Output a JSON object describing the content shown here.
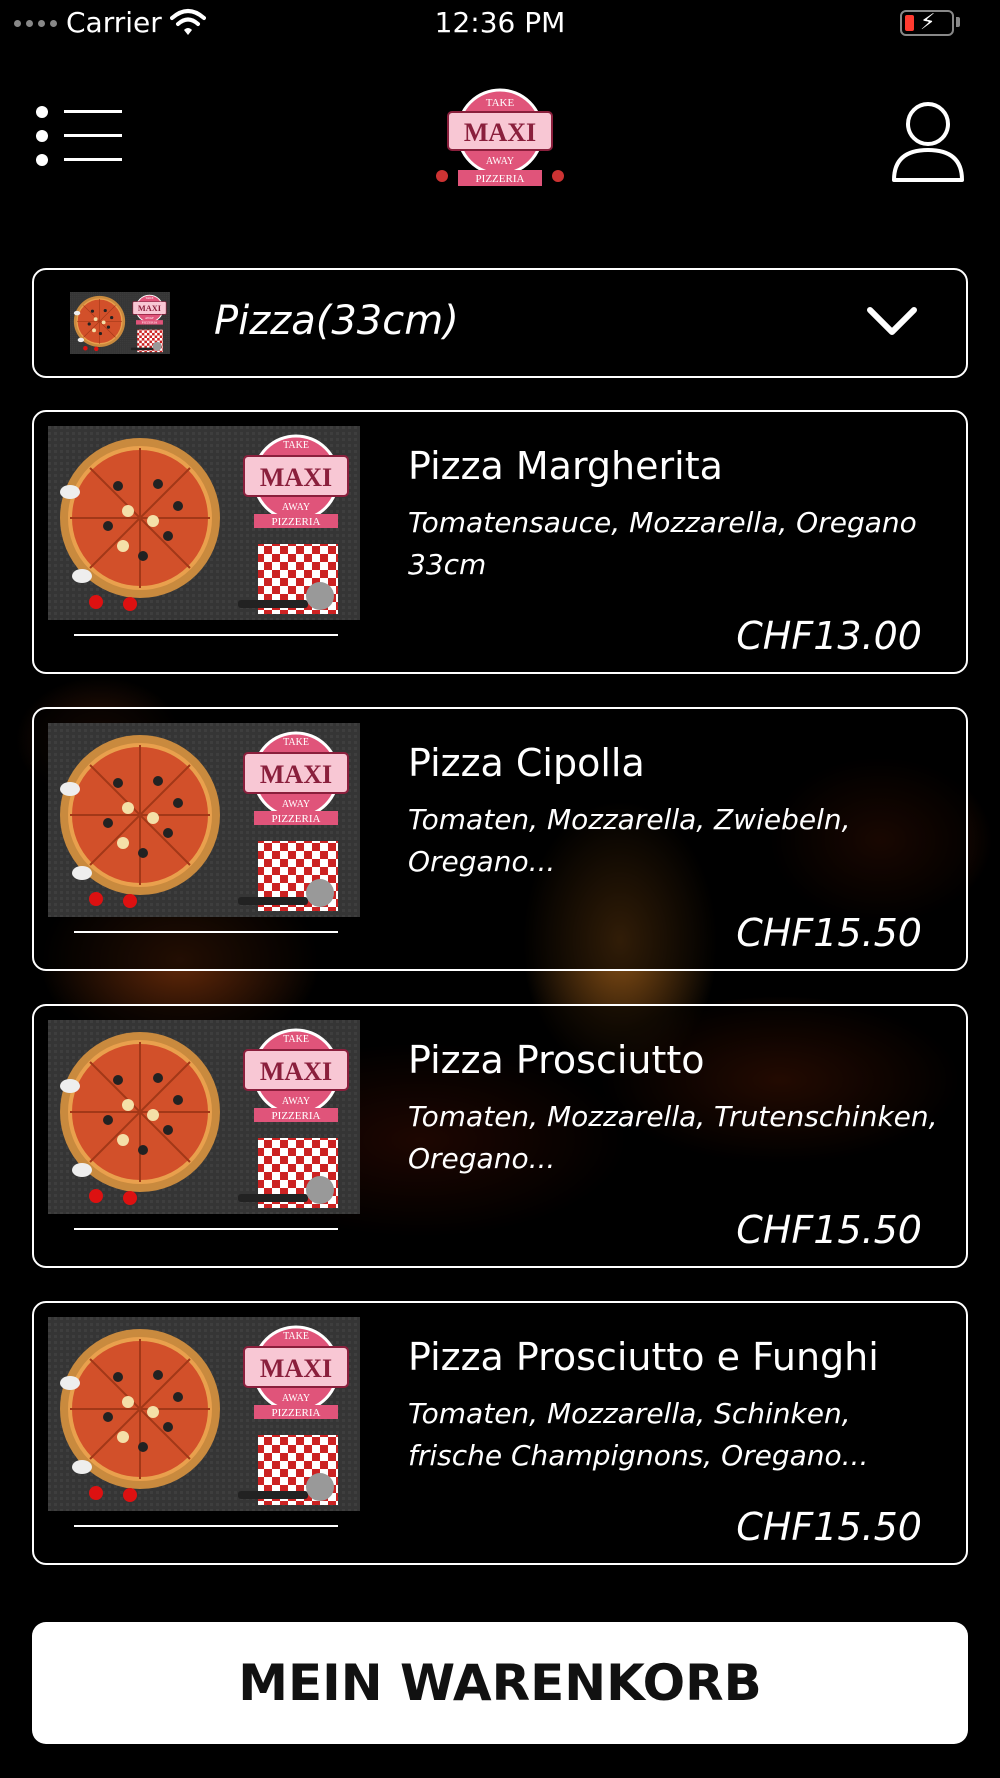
{
  "status_bar": {
    "carrier": "Carrier",
    "time": "12:36 PM"
  },
  "header": {
    "menu_icon": "hamburger-list-icon",
    "logo": {
      "line1": "TAKE",
      "line2": "MAXI",
      "line3": "AWAY",
      "line4": "PIZZERIA"
    },
    "user_icon": "user-icon"
  },
  "category": {
    "label": "Pizza(33cm)",
    "chevron_icon": "chevron-down-icon"
  },
  "products": [
    {
      "name": "Pizza Margherita",
      "description": "Tomatensauce, Mozzarella, Oregano 33cm",
      "price": "CHF13.00"
    },
    {
      "name": "Pizza Cipolla",
      "description": "Tomaten, Mozzarella, Zwiebeln, Oregano...",
      "price": "CHF15.50"
    },
    {
      "name": "Pizza Prosciutto",
      "description": "Tomaten, Mozzarella, Trutenschinken, Oregano...",
      "price": "CHF15.50"
    },
    {
      "name": "Pizza Prosciutto e Funghi",
      "description": "Tomaten, Mozzarella, Schinken, frische Champignons, Oregano...",
      "price": "CHF15.50"
    }
  ],
  "cart_button": {
    "label": "MEIN WARENKORB"
  },
  "colors": {
    "background": "#000000",
    "card_border": "#ffffff",
    "logo_pink": "#e0547a",
    "logo_dark": "#8a1f3c",
    "cart_bg": "#ffffff",
    "cart_text": "#111111"
  }
}
